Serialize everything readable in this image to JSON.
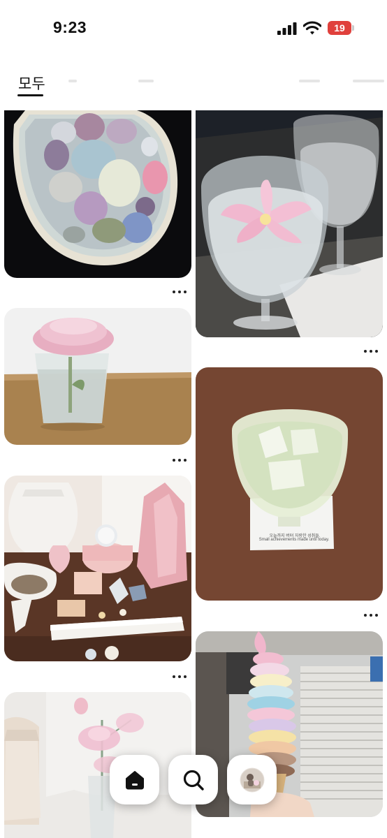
{
  "status_bar": {
    "time": "9:23",
    "battery": "19",
    "icons": [
      "signal-icon",
      "wifi-icon",
      "battery-icon"
    ],
    "battery_color": "#e0403c"
  },
  "tabs": {
    "active_label": "모두"
  },
  "feed": {
    "left_column": [
      {
        "subject": "abalone-shell-with-crystals-photo",
        "menu_icon": "more-options-icon"
      },
      {
        "subject": "pink-peony-in-glass-photo",
        "menu_icon": "more-options-icon"
      },
      {
        "subject": "rose-quartz-and-crystal-shelf-photo",
        "menu_icon": "more-options-icon"
      },
      {
        "subject": "pink-glass-flowers-photo"
      }
    ],
    "right_column": [
      {
        "subject": "lily-in-wine-glass-photo",
        "menu_icon": "more-options-icon"
      },
      {
        "subject": "glass-of-ice-water-on-coaster-photo",
        "menu_icon": "more-options-icon",
        "coaster_text": [
          "오늘까지 버텨 자랑한 성취들.",
          "Small achievements made until today."
        ]
      },
      {
        "subject": "pastel-soft-serve-tower-photo",
        "menu_icon": "more-options-icon"
      }
    ]
  },
  "bottom_nav": {
    "items": [
      "home-icon",
      "search-icon",
      "profile-avatar"
    ]
  }
}
